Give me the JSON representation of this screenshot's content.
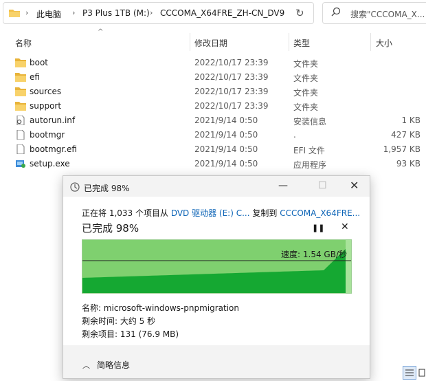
{
  "address": {
    "crumbs": [
      "此电脑",
      "P3 Plus 1TB (M:)",
      "CCCOMA_X64FRE_ZH-CN_DV9"
    ],
    "search_placeholder": "搜索\"CCCOMA_X..."
  },
  "columns": {
    "name": "名称",
    "date": "修改日期",
    "type": "类型",
    "size": "大小"
  },
  "files": [
    {
      "name": "boot",
      "date": "2022/10/17 23:39",
      "type": "文件夹",
      "size": "",
      "icon": "folder-icon"
    },
    {
      "name": "efi",
      "date": "2022/10/17 23:39",
      "type": "文件夹",
      "size": "",
      "icon": "folder-icon"
    },
    {
      "name": "sources",
      "date": "2022/10/17 23:39",
      "type": "文件夹",
      "size": "",
      "icon": "folder-icon"
    },
    {
      "name": "support",
      "date": "2022/10/17 23:39",
      "type": "文件夹",
      "size": "",
      "icon": "folder-icon"
    },
    {
      "name": "autorun.inf",
      "date": "2021/9/14 0:50",
      "type": "安装信息",
      "size": "1 KB",
      "icon": "settings-file-icon"
    },
    {
      "name": "bootmgr",
      "date": "2021/9/14 0:50",
      "type": ".",
      "size": "427 KB",
      "icon": "file-icon"
    },
    {
      "name": "bootmgr.efi",
      "date": "2021/9/14 0:50",
      "type": "EFI 文件",
      "size": "1,957 KB",
      "icon": "file-icon"
    },
    {
      "name": "setup.exe",
      "date": "2021/9/14 0:50",
      "type": "应用程序",
      "size": "93 KB",
      "icon": "setup-exe-icon"
    }
  ],
  "dialog": {
    "title": "已完成 98%",
    "line_prefix": "正在将 1,033 个项目从 ",
    "source": "DVD 驱动器 (E:) C...",
    "line_mid": " 复制到 ",
    "destination": "CCCOMA_X64FRE...",
    "progress_text": "已完成 98%",
    "progress": 0.98,
    "speed": "速度: 1.54 GB/秒",
    "name_line": "名称: microsoft-windows-pnpmigration",
    "time_line": "剩余时间: 大约 5 秒",
    "items_line": "剩余项目: 131 (76.9 MB)",
    "less_details": "简略信息",
    "colors": {
      "graph_bg": "#a8e39a",
      "graph_fill": "#15a832",
      "link": "#0b63b6"
    }
  }
}
